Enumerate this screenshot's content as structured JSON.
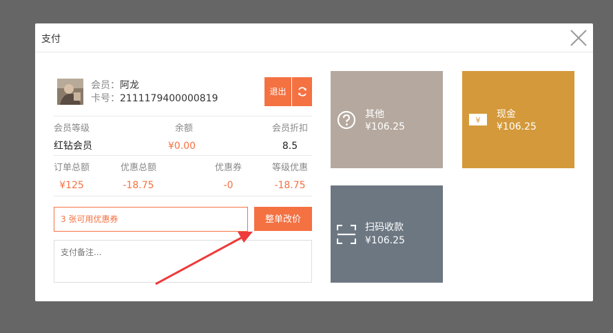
{
  "modal": {
    "title": "支付"
  },
  "member": {
    "name_label": "会员：",
    "name": "阿龙",
    "card_label": "卡号：",
    "card": "2111179400000819",
    "logout_label": "退出"
  },
  "stats1": [
    {
      "key": "会员等级",
      "value": "红钻会员",
      "color": "dark"
    },
    {
      "key": "余额",
      "value": "¥0.00",
      "color": "orange"
    },
    {
      "key": "会员折扣",
      "value": "8.5",
      "color": "dark"
    }
  ],
  "stats2": [
    {
      "key": "订单总额",
      "value": "¥125"
    },
    {
      "key": "优惠总额",
      "value": "-18.75"
    },
    {
      "key": "优惠券",
      "value": "-0"
    },
    {
      "key": "等级优惠",
      "value": "-18.75"
    }
  ],
  "coupon": {
    "text": "3 张可用优惠券",
    "adjust_label": "整单改价"
  },
  "remark": {
    "placeholder": "支付备注..."
  },
  "payments": [
    {
      "name": "其他",
      "amount": "¥106.25",
      "icon": "question-circle-icon",
      "color": "#b5a89e"
    },
    {
      "name": "现金",
      "amount": "¥106.25",
      "icon": "cash-icon",
      "color": "#d4993a"
    },
    {
      "name": "扫码收款",
      "amount": "¥106.25",
      "icon": "scan-icon",
      "color": "#6c7782"
    }
  ],
  "colors": {
    "accent": "#f47142",
    "overlay": "#666666"
  }
}
